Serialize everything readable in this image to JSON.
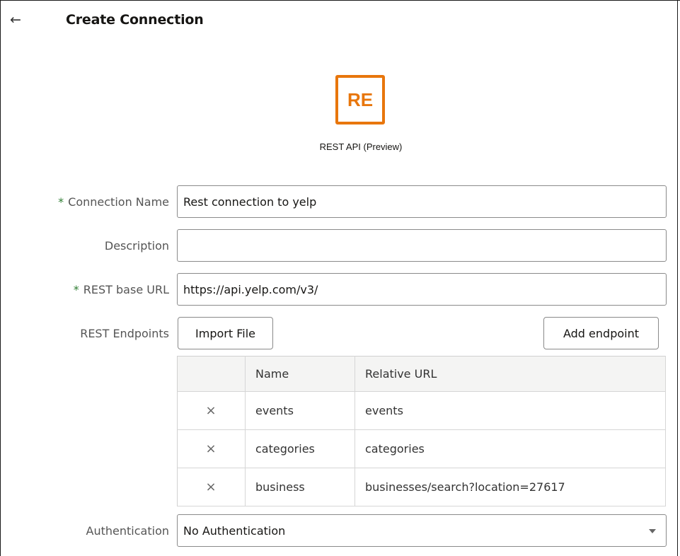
{
  "header": {
    "back_icon": "←",
    "title": "Create Connection"
  },
  "connector": {
    "logo_text": "RE",
    "logo_color": "#e8760c",
    "type_label": "REST API (Preview)"
  },
  "form": {
    "required_marker": "*",
    "connection_name": {
      "label": "Connection Name",
      "value": "Rest connection to yelp"
    },
    "description": {
      "label": "Description",
      "value": ""
    },
    "base_url": {
      "label": "REST base URL",
      "value": "https://api.yelp.com/v3/"
    },
    "endpoints": {
      "label": "REST Endpoints",
      "import_button": "Import File",
      "add_button": "Add endpoint",
      "columns": [
        "",
        "Name",
        "Relative URL"
      ],
      "rows": [
        {
          "delete_icon": "×",
          "name": "events",
          "url": "events"
        },
        {
          "delete_icon": "×",
          "name": "categories",
          "url": "categories"
        },
        {
          "delete_icon": "×",
          "name": "business",
          "url": "businesses/search?location=27617"
        }
      ]
    },
    "authentication": {
      "label": "Authentication",
      "value": "No Authentication"
    }
  }
}
